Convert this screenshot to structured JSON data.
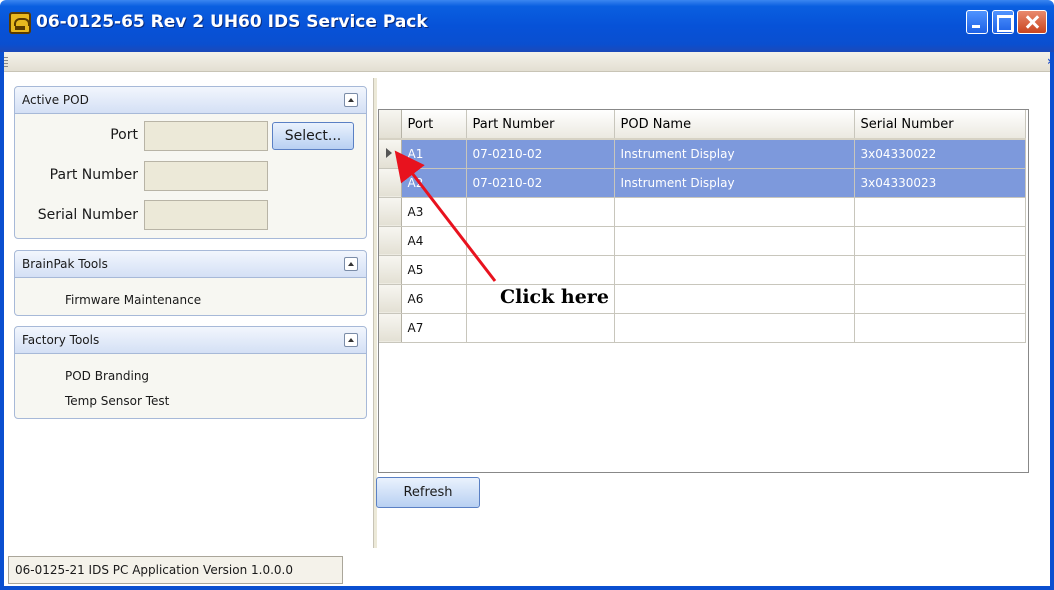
{
  "window": {
    "title": "06-0125-65 Rev 2 UH60 IDS Service Pack",
    "icon": "shield-app-icon"
  },
  "active_pod": {
    "title": "Active POD",
    "port_label": "Port",
    "part_number_label": "Part Number",
    "serial_number_label": "Serial Number",
    "port_value": "",
    "part_number_value": "",
    "serial_number_value": "",
    "select_button": "Select..."
  },
  "brainpak_tools": {
    "title": "BrainPak Tools",
    "items": [
      "Firmware Maintenance"
    ]
  },
  "factory_tools": {
    "title": "Factory Tools",
    "items": [
      "POD Branding",
      "Temp Sensor Test"
    ]
  },
  "grid": {
    "columns": [
      "Port",
      "Part Number",
      "POD Name",
      "Serial Number"
    ],
    "rows": [
      {
        "port": "A1",
        "part_number": "07-0210-02",
        "pod_name": "Instrument Display",
        "serial_number": "3x04330022",
        "selected": true
      },
      {
        "port": "A2",
        "part_number": "07-0210-02",
        "pod_name": "Instrument Display",
        "serial_number": "3x04330023",
        "selected": true
      },
      {
        "port": "A3",
        "part_number": "",
        "pod_name": "",
        "serial_number": "",
        "selected": false
      },
      {
        "port": "A4",
        "part_number": "",
        "pod_name": "",
        "serial_number": "",
        "selected": false
      },
      {
        "port": "A5",
        "part_number": "",
        "pod_name": "",
        "serial_number": "",
        "selected": false
      },
      {
        "port": "A6",
        "part_number": "",
        "pod_name": "",
        "serial_number": "",
        "selected": false
      },
      {
        "port": "A7",
        "part_number": "",
        "pod_name": "",
        "serial_number": "",
        "selected": false
      }
    ]
  },
  "refresh_button": "Refresh",
  "status": "06-0125-21 IDS PC Application Version 1.0.0.0",
  "annotation": {
    "text": "Click here",
    "color": "#e8121e"
  },
  "colors": {
    "selection": "#7d99dc",
    "titlebar": "#0752d8"
  }
}
